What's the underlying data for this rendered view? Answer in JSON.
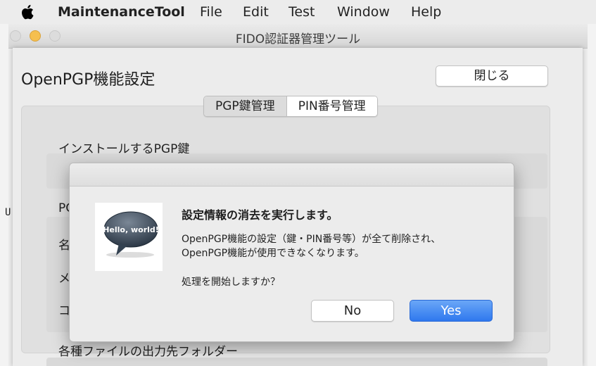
{
  "menubar": {
    "app_name": "MaintenanceTool",
    "items": [
      "File",
      "Edit",
      "Test",
      "Window",
      "Help"
    ]
  },
  "background_char": "U",
  "window": {
    "title": "FIDO認証器管理ツール"
  },
  "page": {
    "title": "OpenPGP機能設定",
    "close_label": "閉じる",
    "tabs": [
      {
        "label": "PGP鍵管理",
        "selected": true
      },
      {
        "label": "PIN番号管理",
        "selected": false
      }
    ],
    "install_label": "インストールするPGP鍵",
    "section_partial": "PG",
    "row_partials": [
      "名",
      "メ",
      "コ"
    ],
    "output_label": "各種ファイルの出力先フォルダー"
  },
  "alert": {
    "icon_text": "Hello, world!",
    "title": "設定情報の消去を実行します。",
    "message_line1": "OpenPGP機能の設定（鍵・PIN番号等）が全て削除され、",
    "message_line2": "OpenPGP機能が使用できなくなります。",
    "question": "処理を開始しますか？",
    "no_label": "No",
    "yes_label": "Yes"
  },
  "colors": {
    "accent": "#2f78ee",
    "traffic_min": "#f5bf4f"
  }
}
